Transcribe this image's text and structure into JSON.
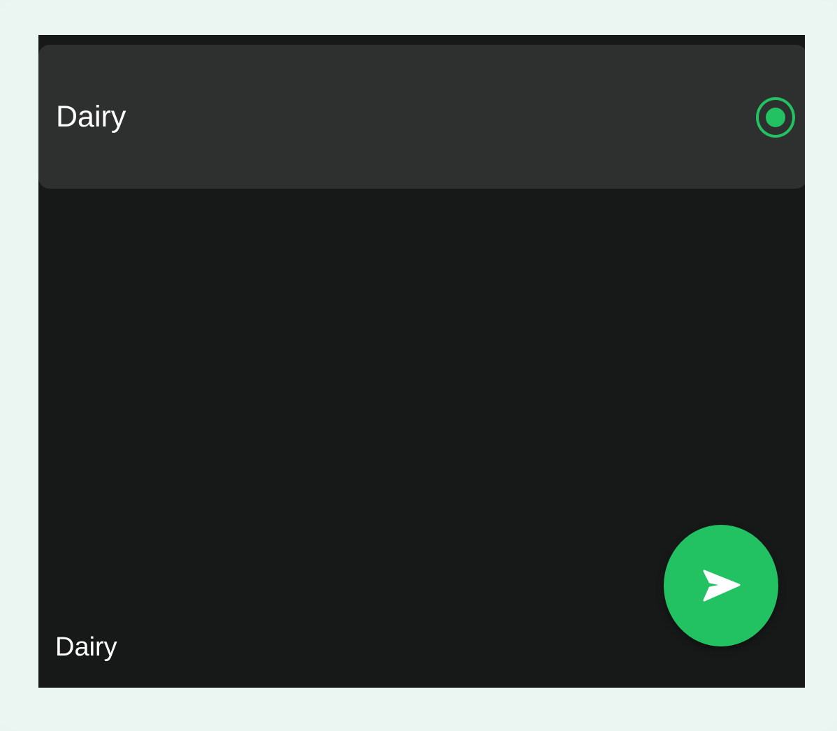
{
  "selected_option": {
    "label": "Dairy",
    "selected": true
  },
  "footer": {
    "label": "Dairy"
  },
  "send_button": {
    "icon": "send-icon"
  },
  "colors": {
    "accent": "#22c263",
    "background": "#171918",
    "card": "#2e302f",
    "frame": "#ebf5f2",
    "text": "#ffffff"
  }
}
